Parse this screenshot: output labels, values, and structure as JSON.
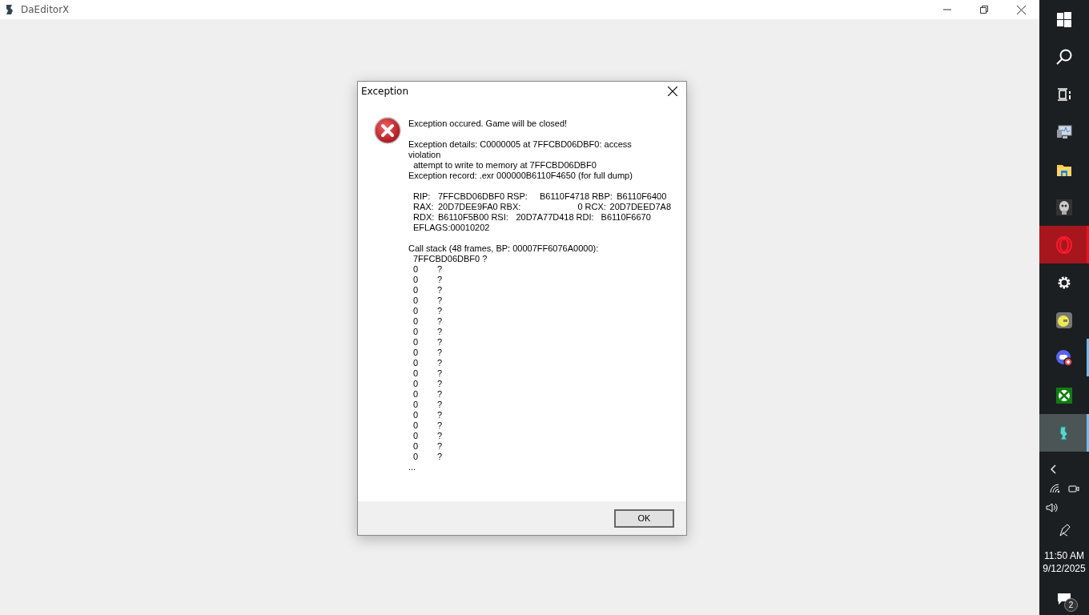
{
  "window": {
    "title": "DaEditorX"
  },
  "dialog": {
    "title": "Exception",
    "message": "Exception occured. Game will be closed!",
    "details": [
      "Exception details: C0000005 at 7FFCBD06DBF0: access violation",
      "  attempt to write to memory at 7FFCBD06DBF0",
      "Exception record: .exr 000000B6110F4650 (for full dump)"
    ],
    "registers": [
      [
        "RIP:",
        "7FFCBD06DBF0",
        "RSP:",
        "B6110F4718",
        "RBP:",
        "B6110F6400"
      ],
      [
        "RAX:",
        "20D7DEE9FA0",
        "RBX:",
        "0",
        "RCX:",
        "20D7DEED7A8"
      ],
      [
        "RDX:",
        "B6110F5B00",
        "RSI:",
        "20D7A77D418",
        "RDI:",
        "B6110F6670"
      ]
    ],
    "flags": "EFLAGS:00010202",
    "call_stack": {
      "header": "Call stack (48 frames, BP: 00007FF6076A0000):",
      "top": "7FFCBD06DBF0 ?",
      "frames": [
        {
          "address": "0",
          "symbol": "?"
        },
        {
          "address": "0",
          "symbol": "?"
        },
        {
          "address": "0",
          "symbol": "?"
        },
        {
          "address": "0",
          "symbol": "?"
        },
        {
          "address": "0",
          "symbol": "?"
        },
        {
          "address": "0",
          "symbol": "?"
        },
        {
          "address": "0",
          "symbol": "?"
        },
        {
          "address": "0",
          "symbol": "?"
        },
        {
          "address": "0",
          "symbol": "?"
        },
        {
          "address": "0",
          "symbol": "?"
        },
        {
          "address": "0",
          "symbol": "?"
        },
        {
          "address": "0",
          "symbol": "?"
        },
        {
          "address": "0",
          "symbol": "?"
        },
        {
          "address": "0",
          "symbol": "?"
        },
        {
          "address": "0",
          "symbol": "?"
        },
        {
          "address": "0",
          "symbol": "?"
        },
        {
          "address": "0",
          "symbol": "?"
        },
        {
          "address": "0",
          "symbol": "?"
        },
        {
          "address": "0",
          "symbol": "?"
        }
      ],
      "more": "..."
    },
    "buttons": [
      "OK"
    ]
  },
  "taskbar": {
    "items": [
      {
        "kind": "start",
        "running": false,
        "active": false
      },
      {
        "kind": "search",
        "running": false,
        "active": false
      },
      {
        "kind": "taskview",
        "running": false,
        "active": false
      },
      {
        "kind": "monitor",
        "running": false,
        "active": false
      },
      {
        "kind": "folder",
        "running": false,
        "active": false
      },
      {
        "kind": "game",
        "running": false,
        "active": false
      },
      {
        "kind": "opera",
        "running": true,
        "active": false
      },
      {
        "kind": "gear",
        "running": false,
        "active": false
      },
      {
        "kind": "gmod",
        "running": false,
        "active": false
      },
      {
        "kind": "discord",
        "running": true,
        "active": false
      },
      {
        "kind": "xbox",
        "running": false,
        "active": false
      },
      {
        "kind": "editor",
        "running": true,
        "active": true
      }
    ],
    "time": "11:50 AM",
    "date": "9/12/2025",
    "notifications": "2"
  }
}
